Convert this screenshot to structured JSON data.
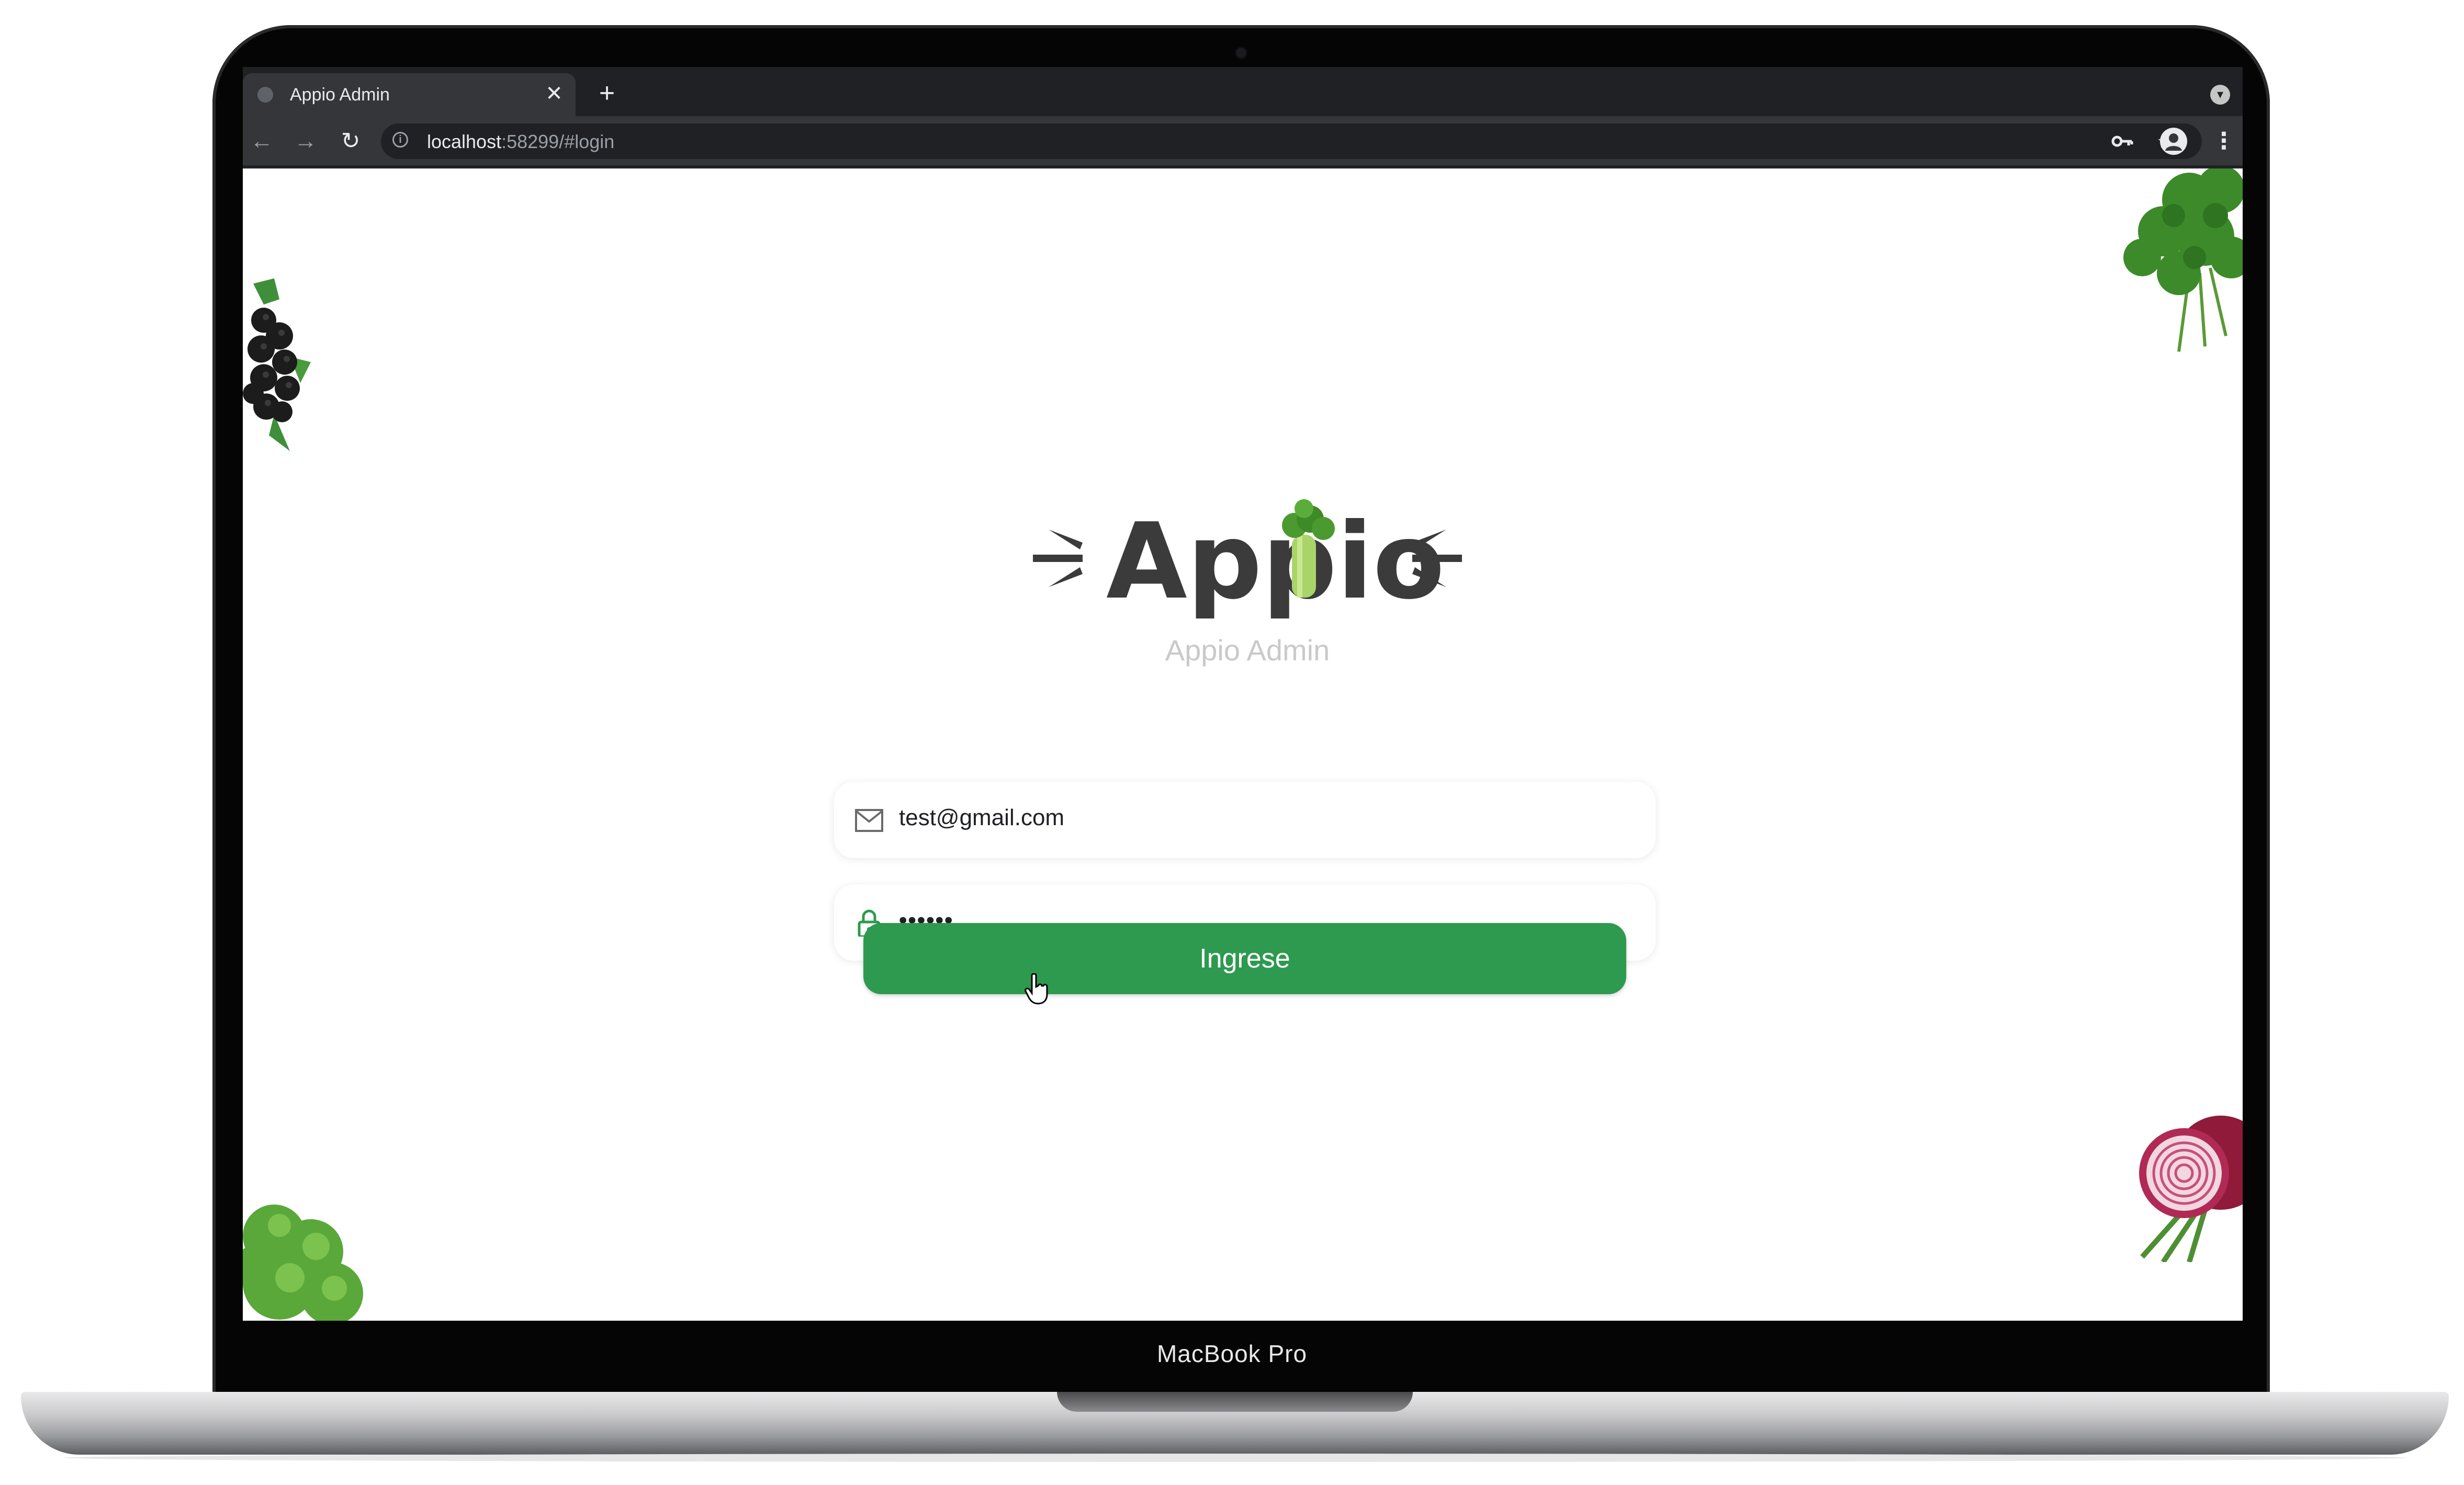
{
  "browser": {
    "tab_title": "Appio Admin",
    "url_host": "localhost",
    "url_rest": ":58299/#login",
    "new_tab": "+",
    "close_tab": "✕"
  },
  "login": {
    "logo_text": "Appio",
    "subtitle": "Appio Admin",
    "email_value": "test@gmail.com",
    "password_value": "••••••",
    "submit_label": "Ingrese",
    "accent_color": "#2e9a4f"
  },
  "device": {
    "label": "MacBook Pro"
  }
}
